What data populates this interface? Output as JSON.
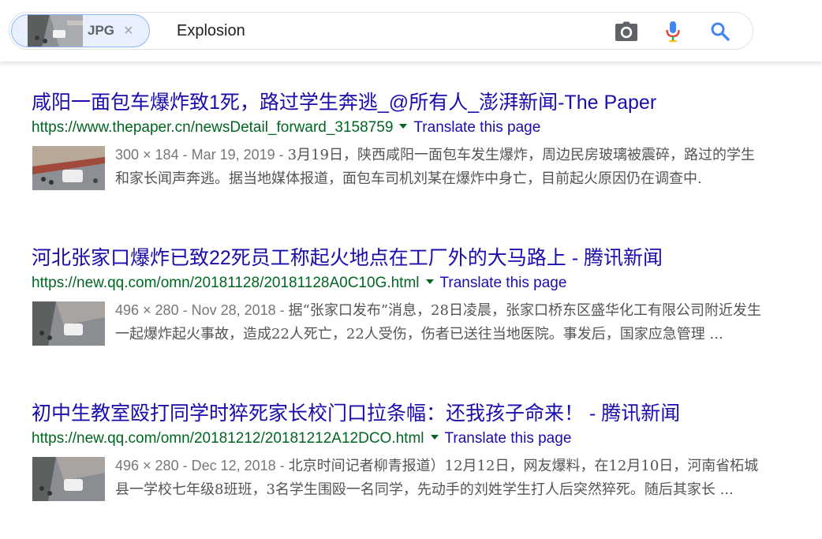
{
  "search": {
    "chip_label": "JPG",
    "chip_close": "×",
    "query": "Explosion",
    "icons": {
      "camera": "camera-icon",
      "mic": "microphone-icon",
      "search": "search-icon"
    }
  },
  "colors": {
    "title_link": "#1a0dab",
    "url_green": "#006621",
    "snippet": "#545454",
    "meta_gray": "#777777",
    "chip_bg": "#e8f0fe",
    "chip_border": "#8ab4f8",
    "mic_blue": "#4285f4",
    "mic_red": "#ea4335",
    "search_blue": "#4285f4",
    "camera_gray": "#5f6368"
  },
  "results": [
    {
      "title": "咸阳一面包车爆炸致1死，路过学生奔逃_@所有人_澎湃新闻-The Paper",
      "url": "https://www.thepaper.cn/newsDetail_forward_3158759",
      "translate": "Translate this page",
      "meta": "300 × 184 - Mar 19, 2019 - ",
      "snippet": "3月19日，陕西咸阳一面包车发生爆炸，周边民房玻璃被震碎，路过的学生和家长闻声奔逃。据当地媒体报道，面包车司机刘某在爆炸中身亡，目前起火原因仍在调查中."
    },
    {
      "title": "河北张家口爆炸已致22死员工称起火地点在工厂外的大马路上 - 腾讯新闻",
      "url": "https://new.qq.com/omn/20181128/20181128A0C10G.html",
      "translate": "Translate this page",
      "meta": "496 × 280 - Nov 28, 2018 - ",
      "snippet": "据“张家口发布”消息，28日凌晨，张家口桥东区盛华化工有限公司附近发生一起爆炸起火事故，造成22人死亡，22人受伤，伤者已送往当地医院。事发后，国家应急管理 ..."
    },
    {
      "title": "初中生教室殴打同学时猝死家长校门口拉条幅：还我孩子命来！ - 腾讯新闻",
      "url": "https://new.qq.com/omn/20181212/20181212A12DCO.html",
      "translate": "Translate this page",
      "meta": "496 × 280 - Dec 12, 2018 - ",
      "snippet": "北京时间记者柳青报道）12月12日，网友爆料，在12月10日，河南省柘城县一学校七年级8班班，3名学生围殴一名同学，先动手的刘姓学生打人后突然猝死。随后其家长 ..."
    }
  ]
}
